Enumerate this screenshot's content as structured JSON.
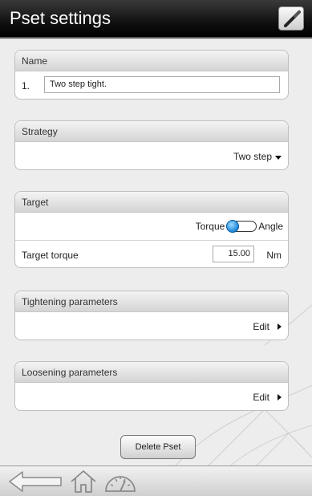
{
  "header": {
    "title": "Pset settings",
    "edit_icon": "pencil-icon"
  },
  "name_section": {
    "header": "Name",
    "index": "1.",
    "value": "Two step tight."
  },
  "strategy_section": {
    "header": "Strategy",
    "selected": "Two step"
  },
  "target_section": {
    "header": "Target",
    "toggle_left_label": "Torque",
    "toggle_right_label": "Angle",
    "toggle_selected": "Torque",
    "target_torque_label": "Target torque",
    "target_torque_value": "15.00",
    "target_torque_unit": "Nm"
  },
  "tightening_section": {
    "header": "Tightening parameters",
    "action": "Edit"
  },
  "loosening_section": {
    "header": "Loosening parameters",
    "action": "Edit"
  },
  "delete_button": "Delete Pset",
  "footer": {
    "icons": [
      "back-arrow-icon",
      "home-icon",
      "gauge-icon"
    ]
  },
  "colors": {
    "header_bg": "#111111",
    "accent_toggle": "#1b86d8"
  }
}
